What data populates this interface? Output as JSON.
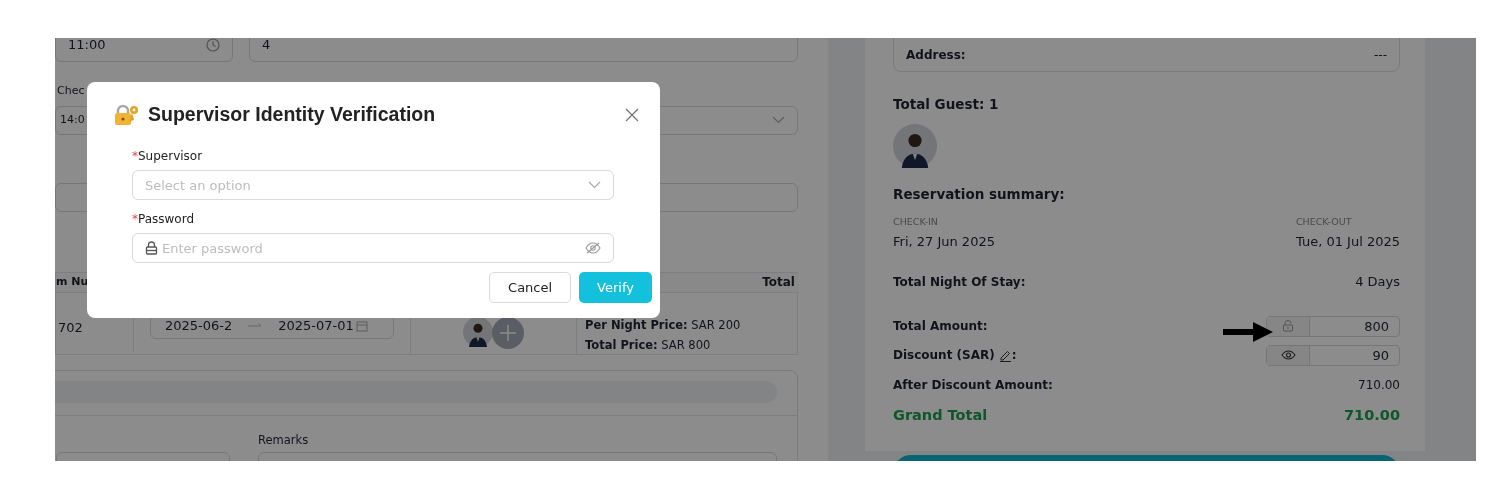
{
  "form": {
    "top_fields": [
      {
        "kind": "time",
        "value": "11:00"
      },
      {
        "kind": "text",
        "value": "4"
      }
    ],
    "check_label": "Chec",
    "check_time": "14:0",
    "table": {
      "columns": [
        "m Nu",
        "Total"
      ],
      "rows": [
        {
          "room": "702",
          "date_from": "2025-06-2",
          "date_to": "2025-07-01",
          "per_night_label": "Per Night Price:",
          "per_night": "SAR 200",
          "total_label": "Total Price:",
          "total": "SAR 800"
        }
      ]
    },
    "remarks_label": "Remarks"
  },
  "summary": {
    "address_label": "Address:",
    "address_value": "---",
    "total_guest": "Total Guest: 1",
    "heading": "Reservation summary:",
    "check_in_label": "CHECK-IN",
    "check_in": "Fri, 27 Jun 2025",
    "check_out_label": "CHECK-OUT",
    "check_out": "Tue, 01 Jul 2025",
    "nights_label": "Total Night Of Stay:",
    "nights": "4 Days",
    "totals": [
      {
        "kind": "lock_input",
        "label": "Total Amount:",
        "value": "800",
        "editable": false
      },
      {
        "kind": "eye_input",
        "label": "Discount (SAR)",
        "suffix": ":",
        "value": "90",
        "editable": true
      },
      {
        "kind": "text",
        "label": "After Discount Amount:",
        "value": "710.00",
        "editable": false
      },
      {
        "kind": "grand",
        "label": "Grand Total",
        "value": "710.00",
        "editable": false
      }
    ]
  },
  "modal": {
    "title": "Supervisor Identity Verification",
    "fields": [
      {
        "kind": "select",
        "required_mark": "*",
        "label": "Supervisor",
        "placeholder": "Select an option"
      },
      {
        "kind": "password",
        "required_mark": "*",
        "label": "Password",
        "placeholder": "Enter password"
      }
    ],
    "buttons": [
      {
        "kind": "secondary",
        "label": "Cancel"
      },
      {
        "kind": "primary",
        "label": "Verify"
      }
    ]
  }
}
